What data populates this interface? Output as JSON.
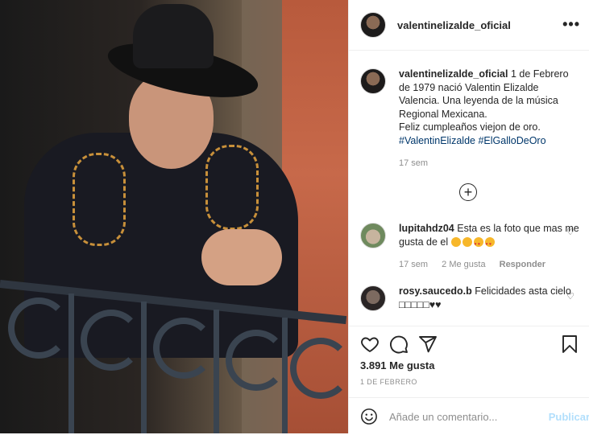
{
  "post": {
    "username": "valentinelizalde_oficial",
    "more_label": "•••",
    "caption": {
      "username": "valentinelizalde_oficial",
      "text": "1 de Febrero de 1979 nació Valentin Elizalde Valencia. Una leyenda de la música Regional Mexicana.",
      "line2": "Feliz cumpleaños viejon de oro.",
      "hashtags": [
        "#ValentinElizalde",
        "#ElGalloDeOro"
      ],
      "time": "17 sem"
    },
    "load_more_label": "+",
    "comments": [
      {
        "username": "lupitahdz04",
        "text": "Esta es la foto que mas me gusta de el",
        "time": "17 sem",
        "likes": "2 Me gusta",
        "reply": "Responder"
      },
      {
        "username": "rosy.saucedo.b",
        "text": "Felicidades asta cielo □□□□□♥♥"
      }
    ],
    "likes": "3.891 Me gusta",
    "date": "1 DE FEBRERO",
    "comment_placeholder": "Añade un comentario...",
    "publish_label": "Publicar"
  },
  "icons": [
    "heart-icon",
    "comment-icon",
    "share-icon",
    "bookmark-icon",
    "smile-icon",
    "ellipsis-icon",
    "plus-circle-icon"
  ],
  "colors": {
    "hashtag": "#00376b",
    "muted": "#8e8e8e",
    "publish": "#b2dffc",
    "text": "#262626"
  }
}
